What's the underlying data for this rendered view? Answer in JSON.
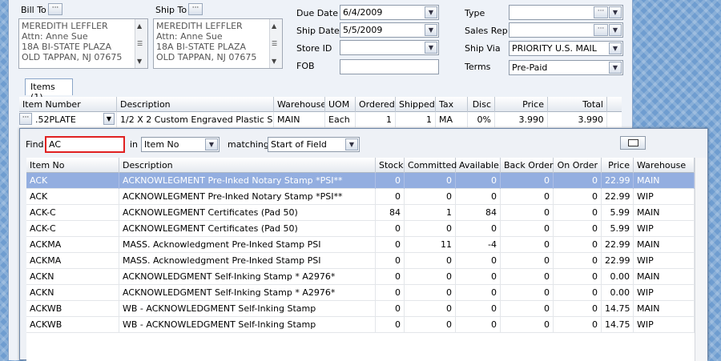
{
  "order": {
    "bill_to_label": "Bill To",
    "ship_to_label": "Ship To",
    "bill_to_lines": [
      "MEREDITH LEFFLER",
      "Attn: Anne Sue",
      "18A BI-STATE PLAZA",
      "OLD TAPPAN, NJ 07675"
    ],
    "ship_to_lines": [
      "MEREDITH LEFFLER",
      "Attn: Anne Sue",
      "18A BI-STATE PLAZA",
      "OLD TAPPAN, NJ 07675"
    ],
    "due_date_label": "Due Date",
    "due_date": "6/4/2009",
    "ship_date_label": "Ship Date",
    "ship_date": "5/5/2009",
    "store_id_label": "Store ID",
    "store_id": "",
    "fob_label": "FOB",
    "fob": "",
    "type_label": "Type",
    "type": "",
    "sales_rep_label": "Sales Rep",
    "sales_rep": "",
    "ship_via_label": "Ship Via",
    "ship_via": "PRIORITY U.S. MAIL",
    "terms_label": "Terms",
    "terms": "Pre-Paid"
  },
  "items_tab": "Items (1)",
  "items_grid": {
    "headers": [
      "Item Number",
      "Description",
      "Warehouse",
      "UOM",
      "Ordered",
      "Shipped",
      "Tax",
      "Disc",
      "Price",
      "Total"
    ],
    "row": {
      "item_number": ".52PLATE",
      "description": "1/2 X 2 Custom Engraved Plastic S",
      "warehouse": "MAIN",
      "uom": "Each",
      "ordered": "1",
      "shipped": "1",
      "tax": "MA",
      "disc": "0%",
      "price": "3.990",
      "total": "3.990"
    }
  },
  "finder": {
    "find_label": "Find",
    "find_value": "AC",
    "in_label": "in",
    "in_value": "Item No",
    "matching_label": "matching",
    "matching_value": "Start of Field",
    "headers": [
      "Item No",
      "Description",
      "Stock",
      "Committed",
      "Available",
      "Back Order",
      "On Order",
      "Price",
      "Warehouse"
    ],
    "rows": [
      [
        "ACK",
        "ACKNOWLEGMENT Pre-Inked Notary Stamp *PSI**",
        "0",
        "0",
        "0",
        "0",
        "0",
        "22.99",
        "MAIN"
      ],
      [
        "ACK",
        "ACKNOWLEGMENT Pre-Inked Notary Stamp *PSI**",
        "0",
        "0",
        "0",
        "0",
        "0",
        "22.99",
        "WIP"
      ],
      [
        "ACK-C",
        "ACKNOWLEGMENT Certificates (Pad 50)",
        "84",
        "1",
        "84",
        "0",
        "0",
        "5.99",
        "MAIN"
      ],
      [
        "ACK-C",
        "ACKNOWLEGMENT Certificates (Pad 50)",
        "0",
        "0",
        "0",
        "0",
        "0",
        "5.99",
        "WIP"
      ],
      [
        "ACKMA",
        "MASS. Acknowledgment Pre-Inked Stamp PSI",
        "0",
        "11",
        "-4",
        "0",
        "0",
        "22.99",
        "MAIN"
      ],
      [
        "ACKMA",
        "MASS. Acknowledgment Pre-Inked Stamp PSI",
        "0",
        "0",
        "0",
        "0",
        "0",
        "22.99",
        "WIP"
      ],
      [
        "ACKN",
        "ACKNOWLEDGMENT Self-Inking Stamp * A2976*",
        "0",
        "0",
        "0",
        "0",
        "0",
        "0.00",
        "MAIN"
      ],
      [
        "ACKN",
        "ACKNOWLEDGMENT Self-Inking Stamp * A2976*",
        "0",
        "0",
        "0",
        "0",
        "0",
        "0.00",
        "WIP"
      ],
      [
        "ACKWB",
        "WB - ACKNOWLEDGMENT Self-Inking Stamp",
        "0",
        "0",
        "0",
        "0",
        "0",
        "14.75",
        "MAIN"
      ],
      [
        "ACKWB",
        "WB - ACKNOWLEDGMENT Self-Inking Stamp",
        "0",
        "0",
        "0",
        "0",
        "0",
        "14.75",
        "WIP"
      ]
    ]
  },
  "colors": {
    "selection": "#93aee0",
    "find_highlight": "#e02020"
  }
}
